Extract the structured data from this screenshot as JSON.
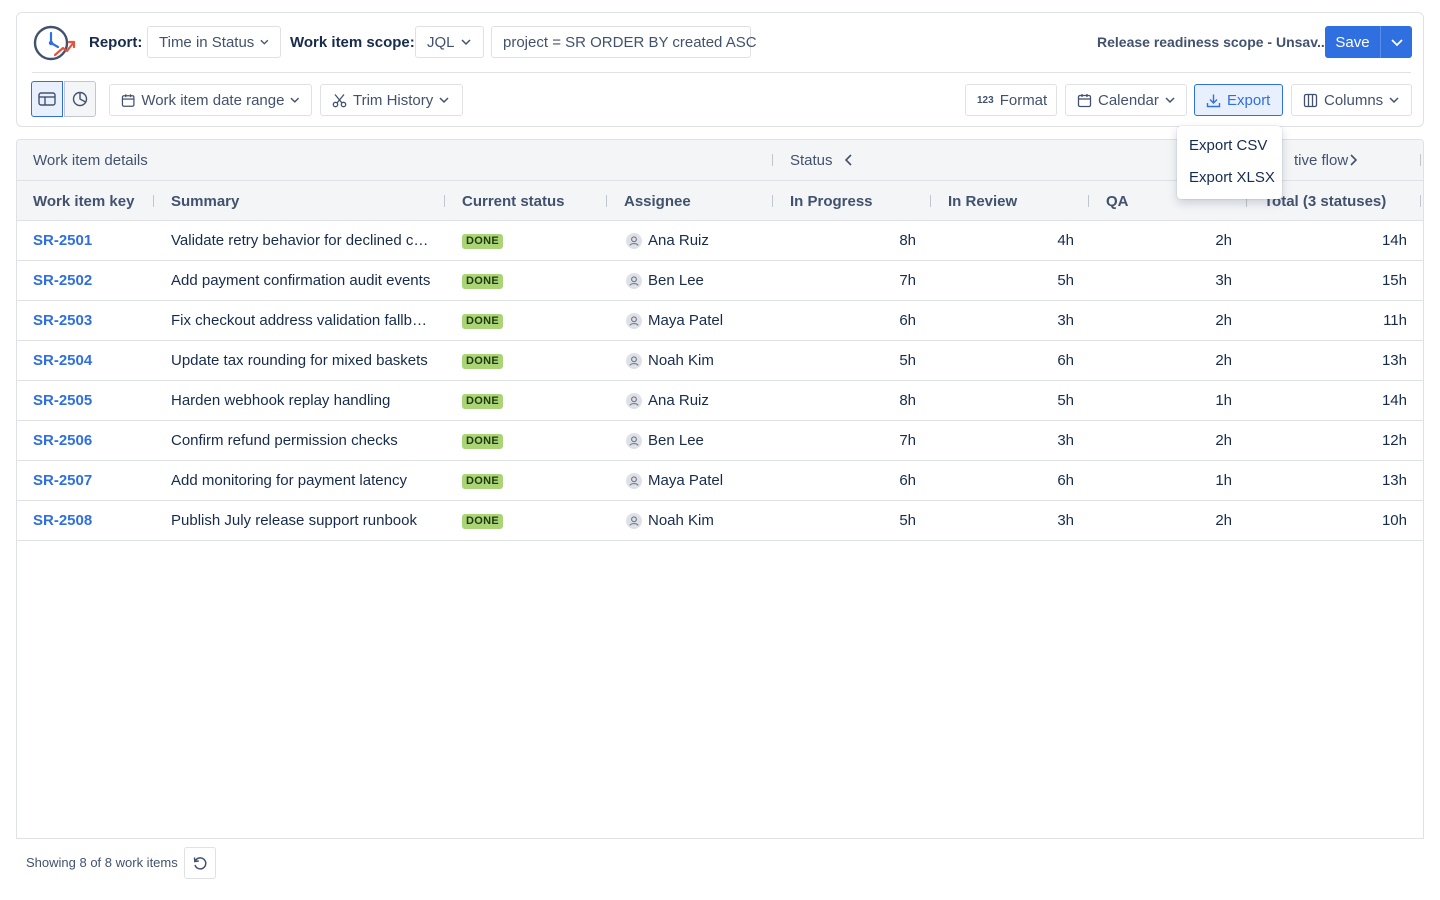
{
  "colors": {
    "accent": "#2f6fe0",
    "done_badge": "#abd476",
    "border": "#dfe1e6"
  },
  "header": {
    "report_label": "Report:",
    "report_value": "Time in Status",
    "scope_label": "Work item scope:",
    "scope_type": "JQL",
    "jql_query": "project = SR ORDER BY created ASC",
    "scope_name": "Release readiness scope - Unsav...",
    "save_label": "Save"
  },
  "toolbar": {
    "date_range_label": "Work item date range",
    "trim_history_label": "Trim History",
    "format_label": "Format",
    "format_icon_text": "123",
    "calendar_label": "Calendar",
    "export_label": "Export",
    "columns_label": "Columns"
  },
  "export_menu": {
    "items": [
      "Export CSV",
      "Export XLSX"
    ]
  },
  "table": {
    "group_headers": {
      "details": "Work item details",
      "status": "Status",
      "flow": "tive flow"
    },
    "columns": [
      "Work item key",
      "Summary",
      "Current status",
      "Assignee",
      "In Progress",
      "In Review",
      "QA",
      "Total (3 statuses)"
    ],
    "rows": [
      {
        "key": "SR-2501",
        "summary": "Validate retry behavior for declined ca...",
        "status": "DONE",
        "assignee": "Ana Ruiz",
        "in_progress": "8h",
        "in_review": "4h",
        "qa": "2h",
        "total": "14h"
      },
      {
        "key": "SR-2502",
        "summary": "Add payment confirmation audit events",
        "status": "DONE",
        "assignee": "Ben Lee",
        "in_progress": "7h",
        "in_review": "5h",
        "qa": "3h",
        "total": "15h"
      },
      {
        "key": "SR-2503",
        "summary": "Fix checkout address validation fallback",
        "status": "DONE",
        "assignee": "Maya Patel",
        "in_progress": "6h",
        "in_review": "3h",
        "qa": "2h",
        "total": "11h"
      },
      {
        "key": "SR-2504",
        "summary": "Update tax rounding for mixed baskets",
        "status": "DONE",
        "assignee": "Noah Kim",
        "in_progress": "5h",
        "in_review": "6h",
        "qa": "2h",
        "total": "13h"
      },
      {
        "key": "SR-2505",
        "summary": "Harden webhook replay handling",
        "status": "DONE",
        "assignee": "Ana Ruiz",
        "in_progress": "8h",
        "in_review": "5h",
        "qa": "1h",
        "total": "14h"
      },
      {
        "key": "SR-2506",
        "summary": "Confirm refund permission checks",
        "status": "DONE",
        "assignee": "Ben Lee",
        "in_progress": "7h",
        "in_review": "3h",
        "qa": "2h",
        "total": "12h"
      },
      {
        "key": "SR-2507",
        "summary": "Add monitoring for payment latency",
        "status": "DONE",
        "assignee": "Maya Patel",
        "in_progress": "6h",
        "in_review": "6h",
        "qa": "1h",
        "total": "13h"
      },
      {
        "key": "SR-2508",
        "summary": "Publish July release support runbook",
        "status": "DONE",
        "assignee": "Noah Kim",
        "in_progress": "5h",
        "in_review": "3h",
        "qa": "2h",
        "total": "10h"
      }
    ]
  },
  "footer": {
    "showing_text": "Showing 8 of 8 work items"
  }
}
